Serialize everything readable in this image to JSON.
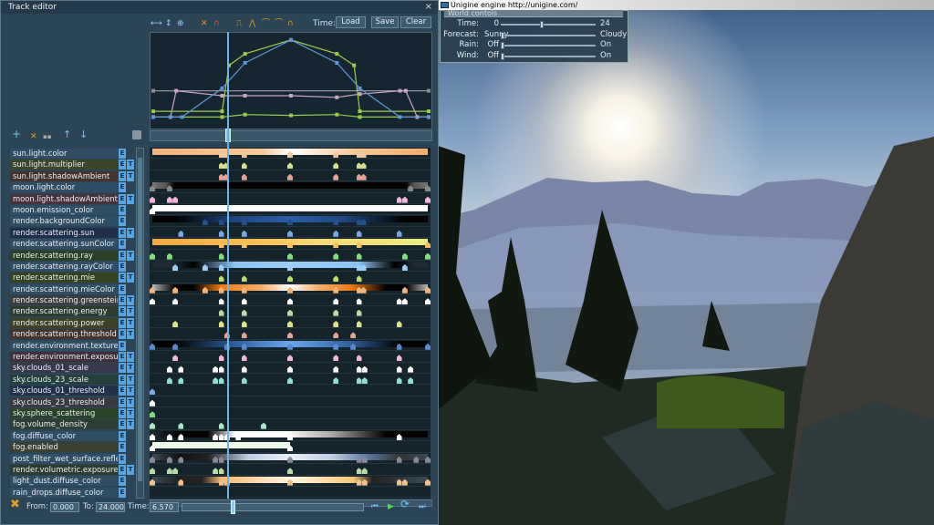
{
  "app_title": "Unigine engine http://unigine.com/",
  "world_controls": {
    "title": "World contols",
    "rows": [
      {
        "label": "Time:",
        "min": "0",
        "max": "24",
        "value": 0.43
      },
      {
        "label": "Forecast:",
        "min": "Sunny",
        "max": "Cloudy",
        "value": 0
      },
      {
        "label": "Rain:",
        "min": "Off",
        "max": "On",
        "value": 0
      },
      {
        "label": "Wind:",
        "min": "Off",
        "max": "On",
        "value": 0
      }
    ]
  },
  "editor": {
    "title": "Track editor",
    "close": "×",
    "toolbar": {
      "time_label": "Time:",
      "load": "Load",
      "save": "Save",
      "clear": "Clear"
    },
    "list_tools": [
      "+",
      "✕",
      "▪▪",
      "↑",
      "↓"
    ],
    "bottom": {
      "from_label": "From:",
      "from": "0.000",
      "to_label": "To:",
      "to": "24.000",
      "time_label": "Time:",
      "time": "6.570"
    },
    "time_range": [
      0,
      24
    ],
    "current_time": 6.57
  },
  "curves": [
    {
      "color": "#8f8f9a",
      "t": [
        0,
        24
      ],
      "v": [
        0.36,
        0.36
      ]
    },
    {
      "color": "#c9a6c0",
      "t": [
        0,
        1.5,
        2,
        6,
        8,
        12,
        16,
        18,
        21.5,
        22,
        23,
        24
      ],
      "v": [
        0.04,
        0.04,
        0.36,
        0.3,
        0.3,
        0.3,
        0.28,
        0.32,
        0.36,
        0.36,
        0.04,
        0.04
      ]
    },
    {
      "color": "#9acb4a",
      "t": [
        0,
        6,
        6.6,
        8,
        12,
        16,
        17.5,
        18,
        24
      ],
      "v": [
        0.11,
        0.11,
        0.67,
        0.81,
        0.98,
        0.81,
        0.67,
        0.11,
        0.11
      ]
    },
    {
      "color": "#9acb4a",
      "t": [
        0,
        6,
        8,
        12,
        16,
        18,
        24
      ],
      "v": [
        0.04,
        0.04,
        0.07,
        0.06,
        0.07,
        0.04,
        0.04
      ]
    },
    {
      "color": "#5f95d8",
      "t": [
        0,
        1.5,
        2.5,
        6,
        8,
        12,
        16,
        18,
        21.5,
        24
      ],
      "v": [
        0.04,
        0.04,
        0.04,
        0.39,
        0.7,
        0.98,
        0.7,
        0.39,
        0.04,
        0.04
      ]
    }
  ],
  "tracks": [
    {
      "name": "sun.light.color",
      "bg": "#2f4d63",
      "t": false,
      "bar": "linear-gradient(90deg,#f5b47a,#f8c898 40%,#fff 50%,#f7c58e 75%,#f3ae70)",
      "key": "#f2c79b",
      "keys": [
        6,
        6.4,
        8,
        12,
        16,
        18,
        18.4
      ]
    },
    {
      "name": "sun.light.multiplier",
      "bg": "#3c4429",
      "t": true,
      "key": "#d5e08d",
      "keys": [
        6,
        6.4,
        8,
        12,
        16,
        18,
        18.4
      ]
    },
    {
      "name": "sun.light.shadowAmbient",
      "bg": "#46322c",
      "t": true,
      "key": "#e6a392",
      "keys": [
        6,
        6.4,
        8,
        12,
        16,
        18,
        18.4
      ]
    },
    {
      "name": "moon.light.color",
      "bg": "#2f4d63",
      "t": false,
      "bar": "linear-gradient(90deg,#777,#555 5%,#000 8%,#000 92%,#555 95%,#777)",
      "key": "#888",
      "keys": [
        0,
        1.5,
        22.5,
        24
      ]
    },
    {
      "name": "moon.light.shadowAmbient",
      "bg": "#48313c",
      "t": true,
      "key": "#f3b4dc",
      "keys": [
        0,
        1.5,
        2,
        21.5,
        22,
        24
      ]
    },
    {
      "name": "moon.emission_color",
      "bg": "#2f4d63",
      "t": false,
      "bar": "#ffffff",
      "key": "#fff",
      "keys": [
        0
      ]
    },
    {
      "name": "render.backgroundColor",
      "bg": "#2f4d63",
      "t": false,
      "bar": "linear-gradient(90deg,#000 8%,#1c4780 30%,#2a5ea8 50%,#1c4780 70%,#000 92%)",
      "key": "#24508a",
      "keys": [
        4.6,
        6,
        8,
        12,
        16,
        18,
        18.4
      ]
    },
    {
      "name": "render.scattering.sun",
      "bg": "#1f2f4a",
      "t": true,
      "key": "#7aa7e8",
      "keys": [
        2.5,
        6,
        8,
        12,
        16,
        18,
        21.5
      ]
    },
    {
      "name": "render.scattering.sunColor",
      "bg": "#2f4d63",
      "t": false,
      "bar": "linear-gradient(90deg,#f5a840,#f7c058 40%,#f8d878 60%,#f3e27a 85%,#e6ee8a)",
      "key": "#f5c060",
      "keys": [
        6,
        8,
        12,
        16,
        18,
        24
      ]
    },
    {
      "name": "render.scattering.ray",
      "bg": "#2b4126",
      "t": true,
      "key": "#7fe07a",
      "keys": [
        0,
        1.5,
        6,
        12,
        16,
        18,
        22,
        24
      ]
    },
    {
      "name": "render.scattering.rayColor",
      "bg": "#2f4d63",
      "t": false,
      "bar": "linear-gradient(90deg,#1d2a33 8%,#000 15%,#8cc4f2 30%,#9ccdf5 50%,#8cc4f2 75%,#000 88%,#1d2a33 95%)",
      "key": "#9ccdf5",
      "keys": [
        2,
        4.6,
        6,
        12,
        18,
        18.4,
        22
      ]
    },
    {
      "name": "render.scattering.mie",
      "bg": "#34441f",
      "t": true,
      "key": "#b8e070",
      "keys": [
        6,
        8,
        12,
        16,
        18
      ]
    },
    {
      "name": "render.scattering.mieColor",
      "bg": "#2f4d63",
      "t": false,
      "bar": "linear-gradient(90deg,#bbb,#000 8%,#000 15%,#f07a10 25%,#f5b070 40%,#fff 50%,#f5b070 60%,#f07a10 72%,#000 85%,#000 92%,#bbb)",
      "key": "#f3b47a",
      "keys": [
        0,
        2,
        4.6,
        6,
        8,
        12,
        16,
        18,
        18.4,
        22,
        24
      ]
    },
    {
      "name": "render.scattering.greenstein",
      "bg": "#3c3c3c",
      "t": true,
      "key": "#fff",
      "keys": [
        0,
        2,
        6,
        8,
        12,
        16,
        18,
        21.5,
        22,
        24
      ]
    },
    {
      "name": "render.scattering.energy",
      "bg": "#2c3d2e",
      "t": true,
      "key": "#b5dca4",
      "keys": [
        6,
        8,
        12,
        16,
        18
      ]
    },
    {
      "name": "render.scattering.power",
      "bg": "#3e4224",
      "t": true,
      "key": "#dde488",
      "keys": [
        2,
        6,
        8,
        12,
        16,
        18,
        21.5
      ]
    },
    {
      "name": "render.scattering.threshold",
      "bg": "#46322c",
      "t": true,
      "key": "#e6a392",
      "keys": [
        6.5,
        8,
        12,
        16,
        17.5
      ]
    },
    {
      "name": "render.environment.texture",
      "bg": "#2f4d63",
      "t": false,
      "bar": "linear-gradient(90deg,#000 8%,#2e5f9e 30%,#6aa6f0 50%,#2e5f9e 72%,#000 90%)",
      "key": "#5a8ac8",
      "keys": [
        0,
        2,
        6.5,
        8,
        12,
        16,
        17.5,
        21.5,
        24
      ]
    },
    {
      "name": "render.environment.exposure",
      "bg": "#40303a",
      "t": true,
      "key": "#f3b4dc",
      "keys": [
        2,
        6,
        8,
        12,
        16,
        18,
        21.5
      ]
    },
    {
      "name": "sky.clouds_01_scale",
      "bg": "#37384a",
      "t": true,
      "key": "#fff",
      "keys": [
        1.5,
        2.5,
        5.5,
        6,
        8,
        12,
        16,
        18,
        18.5,
        21.5,
        22.5
      ]
    },
    {
      "name": "sky.clouds_23_scale",
      "bg": "#24403c",
      "t": true,
      "key": "#8fe0d0",
      "keys": [
        1.5,
        2.5,
        5.5,
        6,
        8,
        12,
        16,
        18,
        18.5,
        21.5,
        22.5
      ]
    },
    {
      "name": "sky.clouds_01_threshold",
      "bg": "#22304a",
      "t": true,
      "key": "#7aa7e8",
      "keys": [
        0
      ]
    },
    {
      "name": "sky.clouds_23_threshold",
      "bg": "#3a3a3e",
      "t": true,
      "key": "#fff",
      "keys": [
        0
      ]
    },
    {
      "name": "sky.sphere_scattering",
      "bg": "#294326",
      "t": true,
      "key": "#7fe07a",
      "keys": [
        0
      ]
    },
    {
      "name": "fog.volume_density",
      "bg": "#2c3d32",
      "t": true,
      "key": "#a8e8c8",
      "keys": [
        0,
        2.5,
        6,
        9.7
      ]
    },
    {
      "name": "fog.diffuse_color",
      "bg": "#2f4d63",
      "t": false,
      "bar": "linear-gradient(90deg,#1d2a33,#000 10%,#000 20%,#fff 30%,#fff 48%,#aaa 65%,#000 85%,#000)",
      "key": "#fff",
      "keys": [
        0,
        1.5,
        2.5,
        5.5,
        6,
        6.5,
        7.5,
        12,
        21.5
      ]
    },
    {
      "name": "fog.enabled",
      "bg": "#3a4032",
      "t": false,
      "bar": "linear-gradient(90deg,#eefbe8 0,#eefbe8 50%,transparent 50%)",
      "key": "#fff",
      "keys": [
        0,
        12
      ]
    },
    {
      "name": "post_filter_wet_surface.reflection",
      "bg": "#2f4d63",
      "t": false,
      "bar": "linear-gradient(90deg,#3a4a55,#111 10%,#222 20%,#bfcfe0 35%,#e8eef8 50%,#bfcfe0 65%,#5a7aa0 78%,#333 90%,#3a4a55)",
      "key": "#889",
      "keys": [
        0,
        1.5,
        2.5,
        5.5,
        6,
        12,
        18,
        18.5,
        21.5,
        23,
        24
      ]
    },
    {
      "name": "render.volumetric.exposure",
      "bg": "#2c3d2e",
      "t": true,
      "key": "#b5dca4",
      "keys": [
        0,
        1.5,
        2,
        5.5,
        6,
        12,
        18,
        18.5
      ]
    },
    {
      "name": "light_dust.diffuse_color",
      "bg": "#2f4d63",
      "t": false,
      "bar": "linear-gradient(90deg,#3a4a55,#222 10%,#222 18%,#f8b870 25%,#fff5e0 50%,#f8c878 73%,#222 80%,#3a4a55)",
      "key": "#f3c08a",
      "keys": [
        0,
        2.5,
        6,
        6.5,
        12,
        18,
        18.5,
        21.5,
        22,
        24
      ]
    },
    {
      "name": "rain_drops.diffuse_color",
      "bg": "#2f4d63",
      "t": false,
      "key": "#fff",
      "keys": []
    }
  ]
}
